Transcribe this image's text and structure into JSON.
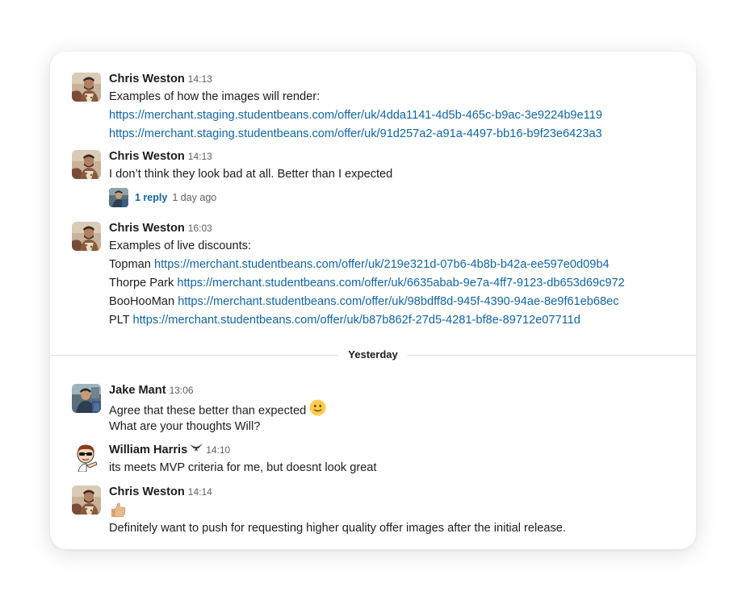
{
  "day_divider": "Yesterday",
  "messages": [
    {
      "author": "Chris Weston",
      "time": "14:13",
      "lines": [
        "Examples of how the images will render:"
      ],
      "links": [
        "https://merchant.staging.studentbeans.com/offer/uk/4dda1141-4d5b-465c-b9ac-3e9224b9e119",
        "https://merchant.staging.studentbeans.com/offer/uk/91d257a2-a91a-4497-bb16-b9f23e6423a3"
      ]
    },
    {
      "author": "Chris Weston",
      "time": "14:13",
      "lines": [
        "I don’t think they look bad at all. Better than I expected"
      ],
      "thread": {
        "count": "1 reply",
        "time": "1 day ago"
      }
    },
    {
      "author": "Chris Weston",
      "time": "16:03",
      "lines": [
        "Examples of live discounts:"
      ],
      "link_rows": [
        {
          "prefix": "Topman",
          "url": "https://merchant.studentbeans.com/offer/uk/219e321d-07b6-4b8b-b42a-ee597e0d09b4"
        },
        {
          "prefix": "Thorpe Park",
          "url": "https://merchant.studentbeans.com/offer/uk/6635abab-9e7a-4ff7-9123-db653d69c972"
        },
        {
          "prefix": "BooHooMan",
          "url": "https://merchant.studentbeans.com/offer/uk/98bdff8d-945f-4390-94ae-8e9f61eb68ec"
        },
        {
          "prefix": "PLT",
          "url": "https://merchant.studentbeans.com/offer/uk/b87b862f-27d5-4281-bf8e-89712e07711d"
        }
      ]
    },
    {
      "author": "Jake Mant",
      "time": "13:06",
      "lines": [
        "Agree that these better than expected",
        "What are your thoughts Will?"
      ],
      "emoji": "slightly-smiling-face-icon"
    },
    {
      "author": "William Harris",
      "time": "14:10",
      "status_emoji": "eagle-icon",
      "lines": [
        "its meets MVP criteria for me, but doesnt look great"
      ]
    },
    {
      "author": "Chris Weston",
      "time": "14:14",
      "emoji": "thumbs-up-icon",
      "lines": [
        "Definitely want to push for requesting higher quality offer images after the initial release."
      ]
    }
  ],
  "colors": {
    "link": "#1264a3",
    "text": "#1d1c1d",
    "muted": "#616061",
    "divider": "#dddddd"
  }
}
